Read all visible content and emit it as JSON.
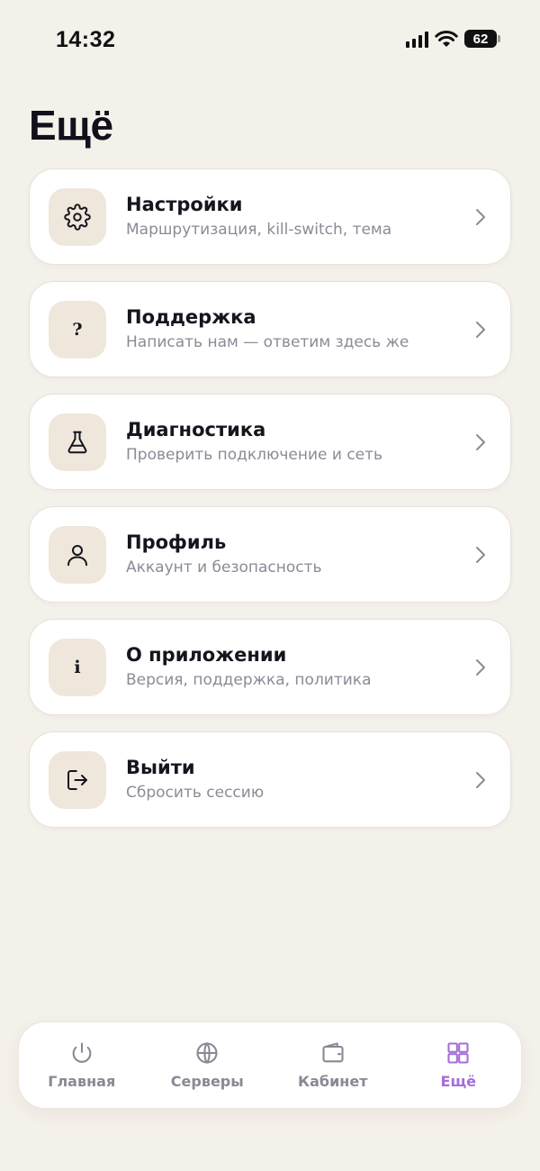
{
  "status_bar": {
    "time": "14:32",
    "battery": "62"
  },
  "page": {
    "title": "Ещё"
  },
  "menu": {
    "items": [
      {
        "title": "Настройки",
        "subtitle": "Маршрутизация, kill-switch, тема",
        "icon": "gear-icon"
      },
      {
        "title": "Поддержка",
        "subtitle": "Написать нам — ответим здесь же",
        "icon": "question-icon",
        "glyph": "?"
      },
      {
        "title": "Диагностика",
        "subtitle": "Проверить подключение и сеть",
        "icon": "flask-icon"
      },
      {
        "title": "Профиль",
        "subtitle": "Аккаунт и безопасность",
        "icon": "user-icon"
      },
      {
        "title": "О приложении",
        "subtitle": "Версия, поддержка, политика",
        "icon": "info-icon",
        "glyph": "i"
      },
      {
        "title": "Выйти",
        "subtitle": "Сбросить сессию",
        "icon": "logout-icon"
      }
    ]
  },
  "tabbar": {
    "tabs": [
      {
        "label": "Главная",
        "icon": "power-icon"
      },
      {
        "label": "Серверы",
        "icon": "globe-icon"
      },
      {
        "label": "Кабинет",
        "icon": "wallet-icon"
      },
      {
        "label": "Ещё",
        "icon": "grid-icon",
        "active": true
      }
    ]
  },
  "colors": {
    "background": "#f4f0ea",
    "card": "#ffffff",
    "icon_tile": "#efe7dc",
    "accent": "#a56ddb",
    "muted_text": "#8c8a96"
  }
}
